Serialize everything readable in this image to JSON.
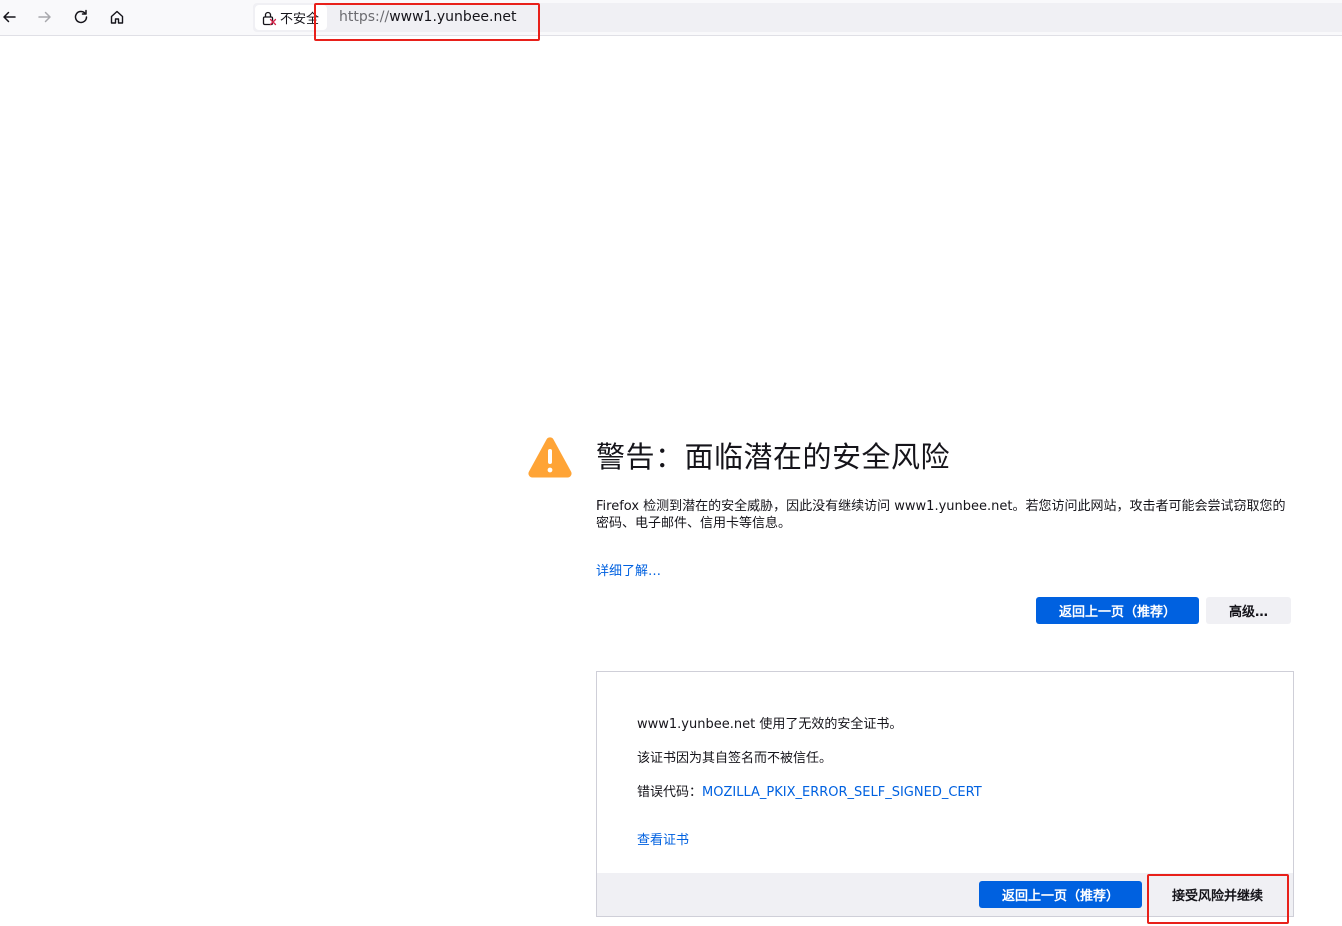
{
  "toolbar": {
    "back_icon": "back-arrow-icon",
    "forward_icon": "forward-arrow-icon",
    "reload_icon": "reload-icon",
    "home_icon": "home-icon",
    "identity_label": "不安全",
    "url_scheme": "https://",
    "url_host": "www1.yunbee.net"
  },
  "warning": {
    "icon": "warning-triangle-icon",
    "title": "警告：面临潜在的安全风险",
    "description": "Firefox 检测到潜在的安全威胁，因此没有继续访问 www1.yunbee.net。若您访问此网站，攻击者可能会尝试窃取您的密码、电子邮件、信用卡等信息。",
    "learn_more": "详细了解…",
    "go_back_button": "返回上一页（推荐）",
    "advanced_button": "高级…"
  },
  "advanced": {
    "line1": "www1.yunbee.net 使用了无效的安全证书。",
    "line2": "该证书因为其自签名而不被信任。",
    "error_code_label": "错误代码：",
    "error_code": "MOZILLA_PKIX_ERROR_SELF_SIGNED_CERT",
    "view_certificate": "查看证书",
    "go_back_button": "返回上一页（推荐）",
    "accept_button": "接受风险并继续"
  },
  "colors": {
    "accent": "#0061e0",
    "warning": "#ffa436",
    "highlight": "#e8201a"
  }
}
